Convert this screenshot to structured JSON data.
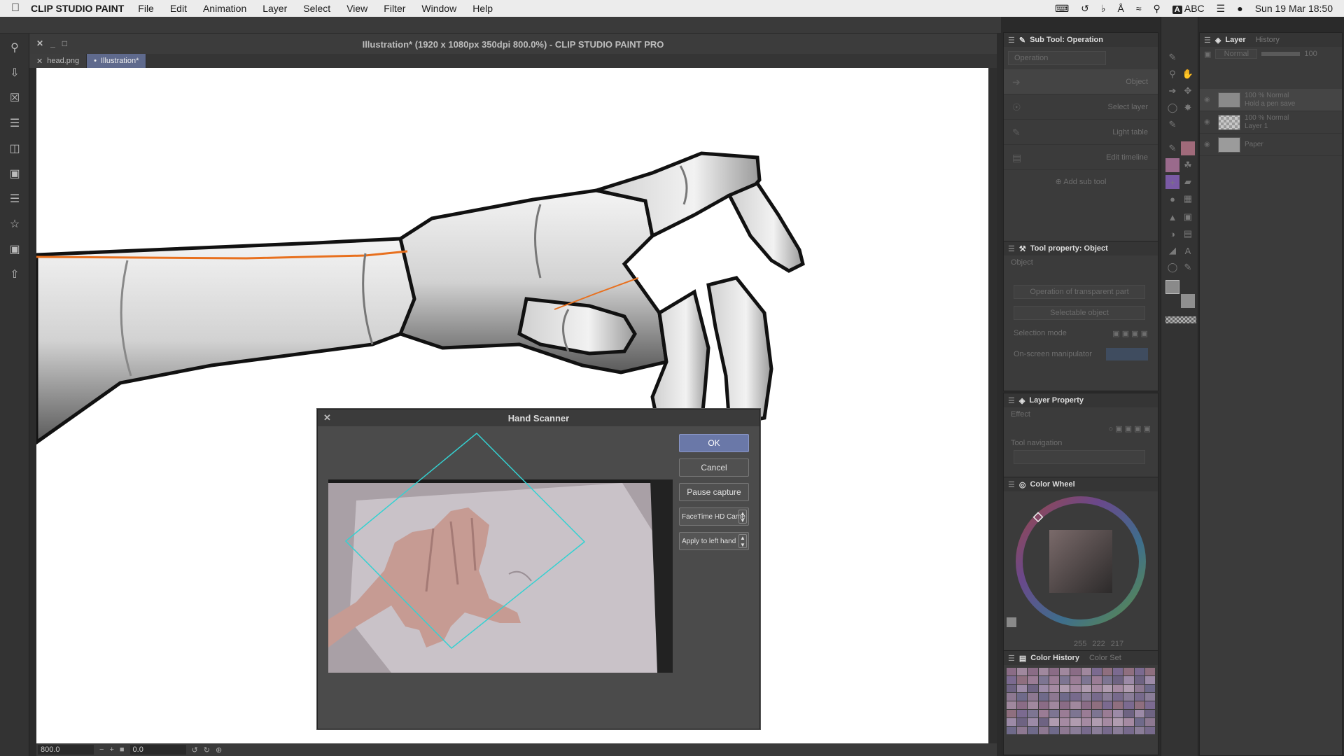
{
  "menubar": {
    "app_name": "CLIP STUDIO PAINT",
    "items": [
      "File",
      "Edit",
      "Animation",
      "Layer",
      "Select",
      "View",
      "Filter",
      "Window",
      "Help"
    ],
    "input_source": "ABC",
    "clock": "Sun 19 Mar  18:50"
  },
  "window": {
    "title": "Illustration* (1920 x 1080px 350dpi 800.0%)  - CLIP STUDIO PAINT PRO"
  },
  "doc_tabs": [
    {
      "label": "head.png",
      "active": false
    },
    {
      "label": "Illustration*",
      "active": true
    }
  ],
  "statusbar": {
    "zoom": "800.0",
    "rotation": "0.0"
  },
  "dialog": {
    "title": "Hand Scanner",
    "ok": "OK",
    "cancel": "Cancel",
    "pause": "Pause capture",
    "camera": "FaceTime HD Came",
    "apply": "Apply to left hand"
  },
  "subtool_panel": {
    "title": "Sub Tool: Operation",
    "group": "Operation",
    "items": [
      "Object",
      "Select layer",
      "Light table",
      "Edit timeline"
    ],
    "add": "Add sub tool"
  },
  "tool_property": {
    "title": "Tool property: Object",
    "section": "Object",
    "transparent": "Operation of transparent part",
    "selectable": "Selectable object",
    "selection_mode": "Selection mode",
    "onscreen": "On-screen manipulator"
  },
  "layer_property": {
    "title": "Layer Property",
    "effect": "Effect",
    "tool_nav": "Tool navigation"
  },
  "color_wheel": {
    "title": "Color Wheel",
    "r": "255",
    "g": "222",
    "b": "217"
  },
  "color_history": {
    "title": "Color History",
    "tab2": "Color Set"
  },
  "layer_panel": {
    "title": "Layer",
    "tab2": "History",
    "blend": "Normal",
    "opacity": "100",
    "layers": [
      {
        "line1": "100 % Normal",
        "line2": "Hold a pen save"
      },
      {
        "line1": "100 % Normal",
        "line2": "Layer 1"
      },
      {
        "line1": "",
        "line2": "Paper"
      }
    ]
  },
  "colors": {
    "accent": "#6a78a8",
    "tab_active": "#5f6a8d",
    "stroke_orange": "#e8701e",
    "hand_outline": "#111111",
    "scanner_frame": "#34d1d1"
  }
}
